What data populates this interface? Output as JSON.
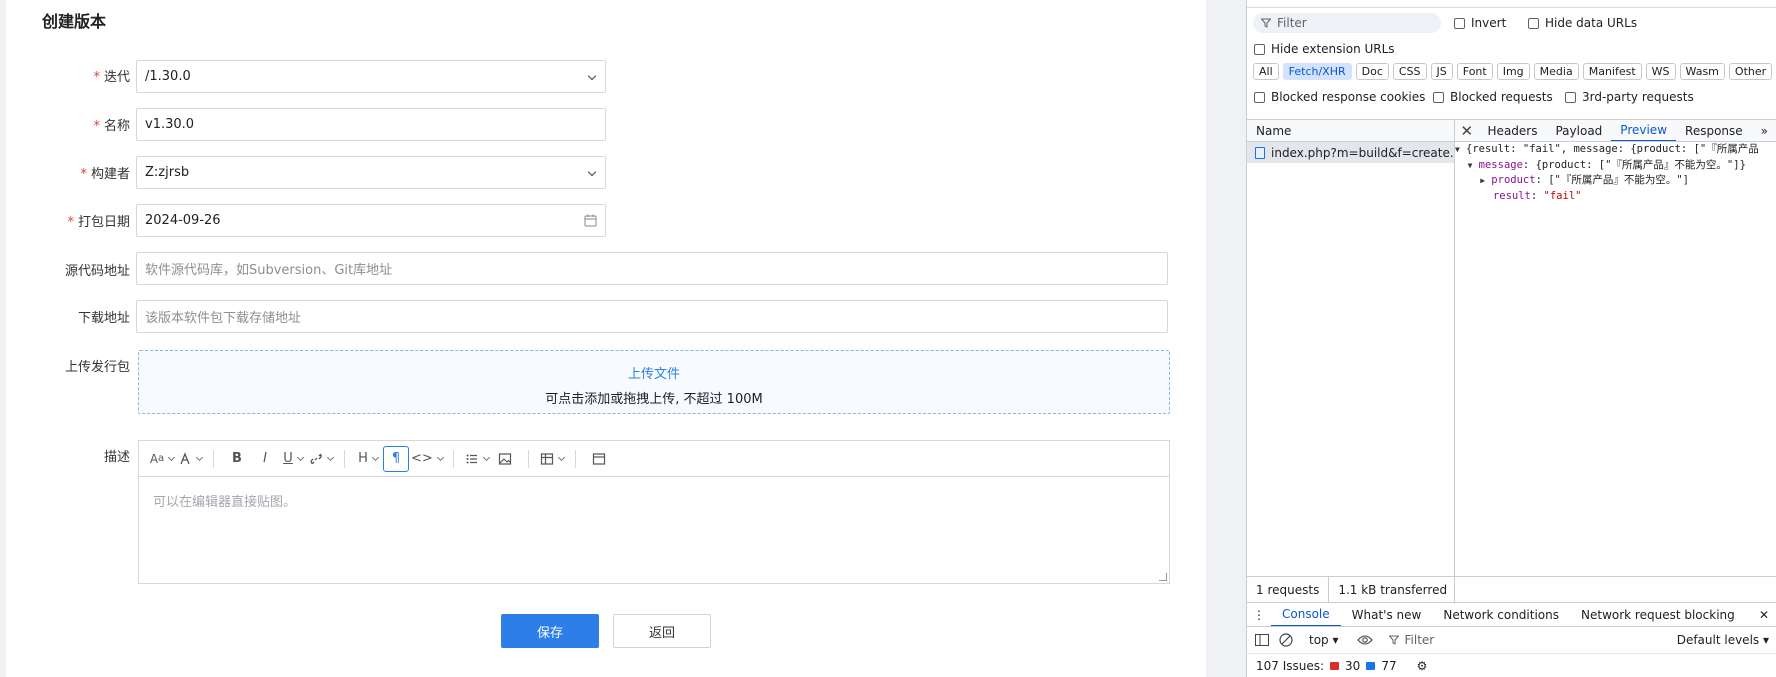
{
  "page": {
    "title": "创建版本"
  },
  "form": {
    "iteration": {
      "label": "迭代",
      "value": "/1.30.0"
    },
    "name": {
      "label": "名称",
      "value": "v1.30.0"
    },
    "builder": {
      "label": "构建者",
      "value": "Z:zjrsb"
    },
    "date": {
      "label": "打包日期",
      "value": "2024-09-26"
    },
    "scm": {
      "label": "源代码地址",
      "placeholder": "软件源代码库，如Subversion、Git库地址"
    },
    "download": {
      "label": "下载地址",
      "placeholder": "该版本软件包下载存储地址"
    },
    "upload": {
      "label": "上传发行包",
      "link": "上传文件",
      "hint": "可点击添加或拖拽上传, 不超过 100M"
    },
    "desc": {
      "label": "描述",
      "placeholder": "可以在编辑器直接贴图。"
    },
    "save": "保存",
    "back": "返回"
  },
  "devtools": {
    "filter_placeholder": "Filter",
    "invert": "Invert",
    "hide_data_urls": "Hide data URLs",
    "hide_ext_urls": "Hide extension URLs",
    "types": [
      "All",
      "Fetch/XHR",
      "Doc",
      "CSS",
      "JS",
      "Font",
      "Img",
      "Media",
      "Manifest",
      "WS",
      "Wasm",
      "Other"
    ],
    "active_type": "Fetch/XHR",
    "blocked_cookies": "Blocked response cookies",
    "blocked_requests": "Blocked requests",
    "third_party": "3rd-party requests",
    "col_name": "Name",
    "request": "index.php?m=build&f=create...",
    "tabs": [
      "Headers",
      "Payload",
      "Preview",
      "Response"
    ],
    "active_tab": "Preview",
    "preview": {
      "line1": "{result: \"fail\", message: {product: [\"『所属产品",
      "line2_key": "message",
      "line2_val": "{product: [\"『所属产品』不能为空。\"]}",
      "line3_key": "product",
      "line3_val": "[\"『所属产品』不能为空。\"]",
      "line4_key": "result",
      "line4_val": "\"fail\""
    },
    "requests_count": "1 requests",
    "transferred": "1.1 kB transferred",
    "drawer_tabs": [
      "Console",
      "What's new",
      "Network conditions",
      "Network request blocking"
    ],
    "context": "top",
    "console_filter": "Filter",
    "levels": "Default levels",
    "issues_label": "107 Issues:",
    "issues_errors": "30",
    "issues_info": "77"
  }
}
